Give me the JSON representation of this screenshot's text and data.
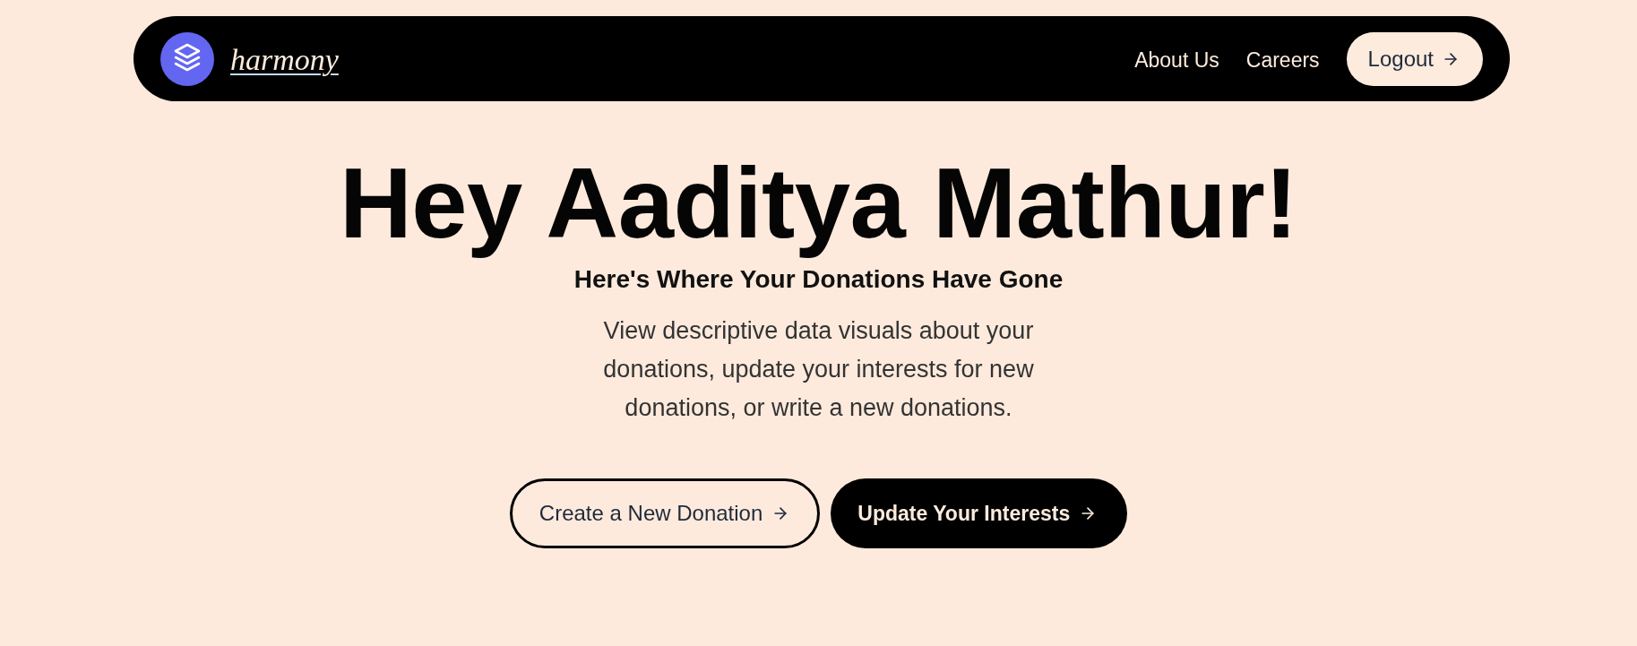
{
  "nav": {
    "logo": {
      "text": "harmony"
    },
    "links": [
      {
        "label": "About Us"
      },
      {
        "label": "Careers"
      }
    ],
    "logout_button": {
      "label": "Logout"
    }
  },
  "hero": {
    "title": "Hey Aaditya Mathur!",
    "subtitle": "Here's Where Your Donations Have Gone",
    "description": "View descriptive data visuals about your donations, update your interests for new donations, or write a new donations."
  },
  "actions": [
    {
      "label": "Create a New Donation",
      "kind": "outline"
    },
    {
      "label": "Update Your Interests",
      "kind": "solid"
    }
  ]
}
